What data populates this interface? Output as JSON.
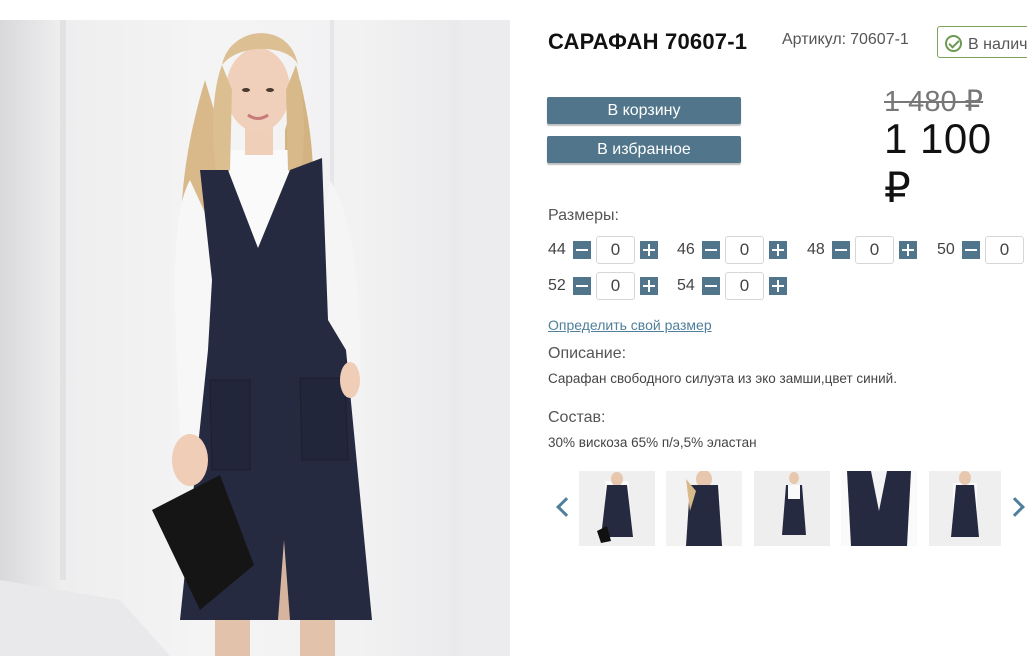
{
  "product": {
    "title": "САРАФАН 70607-1",
    "sku_label": "Артикул:",
    "sku_value": "70607-1",
    "stock_label": "В наличии"
  },
  "buttons": {
    "cart": "В корзину",
    "favorite": "В избранное"
  },
  "price": {
    "old": "1 480 ₽",
    "current": "1 100 ₽"
  },
  "sizes": {
    "label": "Размеры:",
    "items": [
      {
        "size": "44",
        "qty": "0"
      },
      {
        "size": "46",
        "qty": "0"
      },
      {
        "size": "48",
        "qty": "0"
      },
      {
        "size": "50",
        "qty": "0"
      },
      {
        "size": "52",
        "qty": "0"
      },
      {
        "size": "54",
        "qty": "0"
      }
    ],
    "size_link": "Определить свой размер"
  },
  "description": {
    "label": "Описание:",
    "text": "Сарафан свободного силуэта из эко замши,цвет синий."
  },
  "composition": {
    "label": "Состав:",
    "text": "30% вискоза 65% п/э,5% эластан"
  },
  "icons": {
    "stock": "check-circle-icon",
    "prev": "chevron-left-icon",
    "next": "chevron-right-icon",
    "minus": "minus-icon",
    "plus": "plus-icon"
  },
  "colors": {
    "accent": "#51758b",
    "link": "#4f7f9a",
    "stock_border": "#7aa35f",
    "dress": "#262a40"
  }
}
